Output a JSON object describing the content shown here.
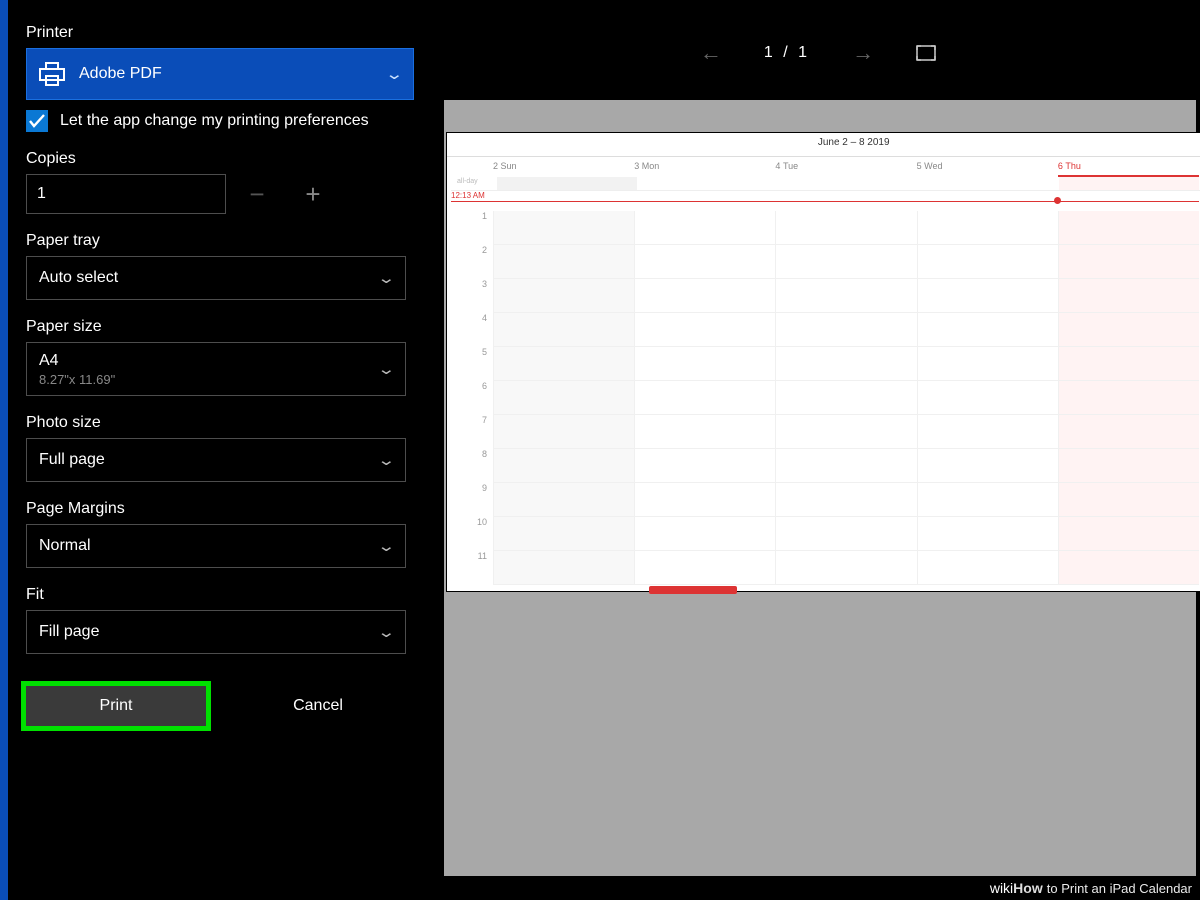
{
  "panel": {
    "printer_label": "Printer",
    "printer_value": "Adobe PDF",
    "change_prefs_label": "Let the app change my printing preferences",
    "copies_label": "Copies",
    "copies_value": "1",
    "paper_tray_label": "Paper tray",
    "paper_tray_value": "Auto select",
    "paper_size_label": "Paper size",
    "paper_size_value": "A4",
    "paper_size_dims": "8.27\"x 11.69\"",
    "photo_size_label": "Photo size",
    "photo_size_value": "Full page",
    "page_margins_label": "Page Margins",
    "page_margins_value": "Normal",
    "fit_label": "Fit",
    "fit_value": "Fill page",
    "print_button": "Print",
    "cancel_button": "Cancel"
  },
  "preview": {
    "page_current": "1",
    "page_separator": "/",
    "page_total": "1",
    "calendar": {
      "title": "June 2 – 8 2019",
      "allday_label": "all-day",
      "now_time": "12:13 AM",
      "days": [
        {
          "num": "2",
          "name": "Sun"
        },
        {
          "num": "3",
          "name": "Mon"
        },
        {
          "num": "4",
          "name": "Tue"
        },
        {
          "num": "5",
          "name": "Wed"
        },
        {
          "num": "6",
          "name": "Thu"
        }
      ],
      "hours": [
        "1",
        "2",
        "3",
        "4",
        "5",
        "6",
        "7",
        "8",
        "9",
        "10",
        "11"
      ]
    }
  },
  "watermark": {
    "brand1": "wiki",
    "brand2": "How",
    "article": " to Print an iPad Calendar"
  }
}
